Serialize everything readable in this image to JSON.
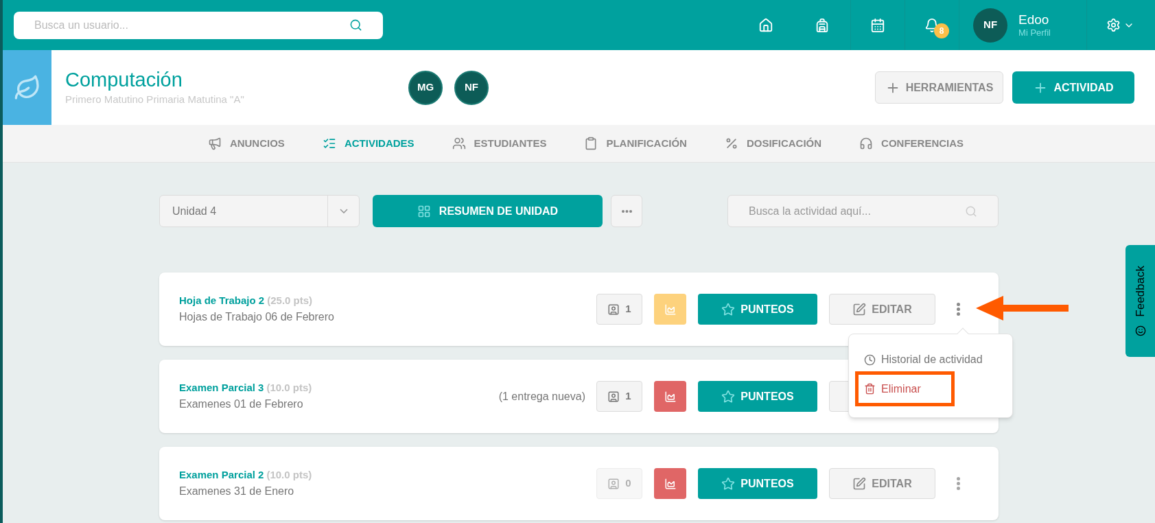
{
  "topbar": {
    "search": {
      "placeholder": "Busca un usuario..."
    },
    "notifications": "8",
    "user": {
      "initials": "NF",
      "name": "Edoo",
      "link": "Mi Perfil"
    }
  },
  "course": {
    "title": "Computación",
    "subtitle": "Primero Matutino Primaria Matutina \"A\"",
    "teachers": [
      "MG",
      "NF"
    ],
    "tools_button": "HERRAMIENTAS",
    "add_button": "ACTIVIDAD"
  },
  "tabs": [
    {
      "label": "ANUNCIOS",
      "selected": false
    },
    {
      "label": "ACTIVIDADES",
      "selected": true
    },
    {
      "label": "ESTUDIANTES",
      "selected": false
    },
    {
      "label": "PLANIFICACIÓN",
      "selected": false
    },
    {
      "label": "DOSIFICACIÓN",
      "selected": false
    },
    {
      "label": "CONFERENCIAS",
      "selected": false
    }
  ],
  "toolbar": {
    "unit": "Unidad 4",
    "summary_button": "RESUMEN DE UNIDAD",
    "search": {
      "placeholder": "Busca la actividad aquí..."
    }
  },
  "activities": [
    {
      "title": "Hoja de Trabajo 2",
      "points": "(25.0 pts)",
      "subtitle": "Hojas de Trabajo 06 de Febrero",
      "submissions": "1",
      "submissions_disabled": false,
      "color": "#fdd27d",
      "grade_button": "PUNTEOS",
      "edit_button": "EDITAR",
      "menu_open": true
    },
    {
      "title": "Examen Parcial 3",
      "points": "(10.0 pts)",
      "subtitle": "Examenes 01 de Febrero",
      "note": "(1 entrega nueva)",
      "submissions": "1",
      "submissions_disabled": false,
      "color": "#e06666",
      "grade_button": "PUNTEOS",
      "menu_open": false
    },
    {
      "title": "Examen Parcial 2",
      "points": "(10.0 pts)",
      "subtitle": "Examenes 31 de Enero",
      "submissions": "0",
      "submissions_disabled": true,
      "color": "#e06666",
      "grade_button": "PUNTEOS",
      "edit_button": "EDITAR",
      "menu_open": false
    }
  ],
  "activity_menu": [
    {
      "kind": "history",
      "label": "Historial de actividad"
    },
    {
      "kind": "delete",
      "label": "Eliminar"
    }
  ],
  "feedback_tab": "Feedback"
}
